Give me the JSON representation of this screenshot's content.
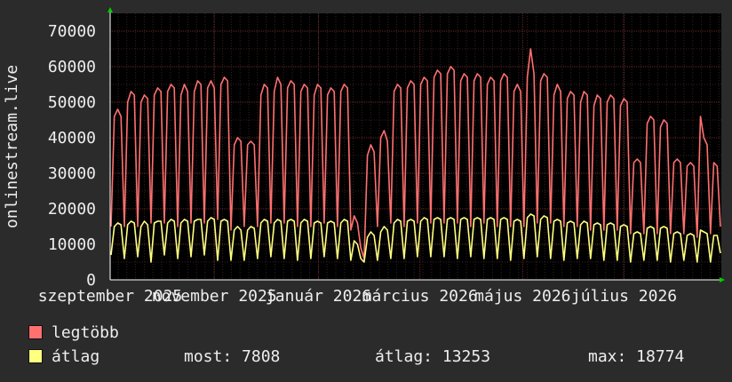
{
  "chart_data": {
    "type": "line",
    "ylabel": "onlinestream.live",
    "ylim": [
      0,
      75000
    ],
    "yticks": [
      0,
      10000,
      20000,
      30000,
      40000,
      50000,
      60000,
      70000
    ],
    "x_ticklabels": [
      "szeptember 2025",
      "november 2025",
      "január 2026",
      "március 2026",
      "május 2026",
      "július 2026"
    ],
    "x_ticklabel_positions": [
      0.0,
      0.1704,
      0.3409,
      0.5068,
      0.6749,
      0.8409
    ],
    "grid": true,
    "series": [
      {
        "name": "legtöbb",
        "color": "#ff7070",
        "values": [
          15000,
          46000,
          48000,
          46000,
          15000,
          50000,
          53000,
          52000,
          15000,
          50000,
          52000,
          51000,
          16000,
          52000,
          54000,
          53000,
          16000,
          53000,
          55000,
          54000,
          15000,
          52000,
          55000,
          53000,
          16000,
          53000,
          56000,
          55000,
          16000,
          54000,
          56000,
          54000,
          17000,
          55000,
          57000,
          56000,
          14000,
          38000,
          40000,
          39000,
          15000,
          38000,
          39000,
          38000,
          15000,
          52000,
          55000,
          54000,
          16000,
          53000,
          57000,
          55000,
          16000,
          54000,
          56000,
          55000,
          15000,
          53000,
          55000,
          54000,
          15000,
          52000,
          55000,
          54000,
          16000,
          52000,
          54000,
          53000,
          15000,
          53000,
          55000,
          54000,
          14000,
          18000,
          16000,
          9000,
          6000,
          35000,
          38000,
          36000,
          15000,
          40000,
          42000,
          39000,
          16000,
          53000,
          55000,
          54000,
          15000,
          54000,
          56000,
          55000,
          16000,
          55000,
          57000,
          56000,
          16000,
          57000,
          59000,
          58000,
          16000,
          58000,
          60000,
          59000,
          16000,
          56000,
          58000,
          57000,
          15000,
          56000,
          58000,
          57000,
          16000,
          55000,
          57000,
          56000,
          15000,
          56000,
          58000,
          57000,
          15000,
          53000,
          55000,
          53000,
          15000,
          57000,
          65000,
          58000,
          16000,
          56000,
          58000,
          57000,
          16000,
          52000,
          55000,
          53000,
          15000,
          51000,
          53000,
          52000,
          15000,
          50000,
          53000,
          52000,
          14000,
          49000,
          52000,
          51000,
          14000,
          50000,
          52000,
          51000,
          14000,
          49000,
          51000,
          50000,
          13000,
          33000,
          34000,
          33000,
          13000,
          44000,
          46000,
          45000,
          13000,
          43000,
          45000,
          44000,
          13000,
          33000,
          34000,
          33000,
          13000,
          32000,
          33000,
          32000,
          12000,
          46000,
          40000,
          38000,
          13000,
          33000,
          32000,
          15000
        ]
      },
      {
        "name": "átlag",
        "color": "#ffff80",
        "values": [
          7000,
          15000,
          16000,
          15500,
          6000,
          15500,
          16500,
          16000,
          6500,
          15000,
          16500,
          15500,
          5000,
          16000,
          16500,
          16500,
          7000,
          16000,
          17000,
          16500,
          6000,
          16000,
          17000,
          16500,
          6500,
          16500,
          17000,
          17000,
          7000,
          16500,
          17500,
          17000,
          5500,
          16500,
          17000,
          16500,
          5500,
          14000,
          15000,
          14000,
          5500,
          14000,
          15000,
          14500,
          6000,
          16000,
          17000,
          16500,
          6500,
          16000,
          17000,
          16500,
          6000,
          16500,
          17000,
          16500,
          5500,
          16000,
          17000,
          16500,
          6000,
          16000,
          16500,
          16000,
          6500,
          16000,
          16500,
          16000,
          6000,
          16000,
          17000,
          16500,
          5500,
          11000,
          10000,
          6000,
          5000,
          12000,
          13500,
          12500,
          5500,
          13500,
          15000,
          14000,
          6000,
          16000,
          17000,
          16500,
          6000,
          16500,
          17000,
          16500,
          6500,
          16500,
          17500,
          17000,
          6500,
          17000,
          17500,
          17000,
          6500,
          17000,
          17500,
          17000,
          6000,
          17000,
          17500,
          17000,
          6500,
          17000,
          17500,
          17000,
          6000,
          17000,
          17500,
          17000,
          6000,
          17000,
          17500,
          17000,
          5500,
          16500,
          17000,
          16500,
          6000,
          17500,
          18500,
          18000,
          6500,
          17000,
          18000,
          17500,
          6000,
          16500,
          17000,
          16500,
          5500,
          16000,
          16500,
          16000,
          6000,
          15500,
          16500,
          16000,
          6000,
          15500,
          16000,
          15500,
          5500,
          15500,
          16000,
          15500,
          5500,
          15000,
          15500,
          15000,
          5000,
          13000,
          13500,
          13000,
          5500,
          14500,
          15000,
          14500,
          5500,
          14500,
          15000,
          14500,
          5000,
          13000,
          13500,
          13000,
          5500,
          12500,
          13000,
          12500,
          5000,
          14000,
          13500,
          13000,
          5000,
          12500,
          12500,
          7500
        ]
      }
    ]
  },
  "legend": [
    {
      "label": "legtöbb",
      "color": "#ff7070"
    },
    {
      "label": "átlag",
      "color": "#ffff80"
    }
  ],
  "stats": {
    "now": "most: 7808",
    "avg": "átlag: 13253",
    "max": "max: 18774"
  }
}
